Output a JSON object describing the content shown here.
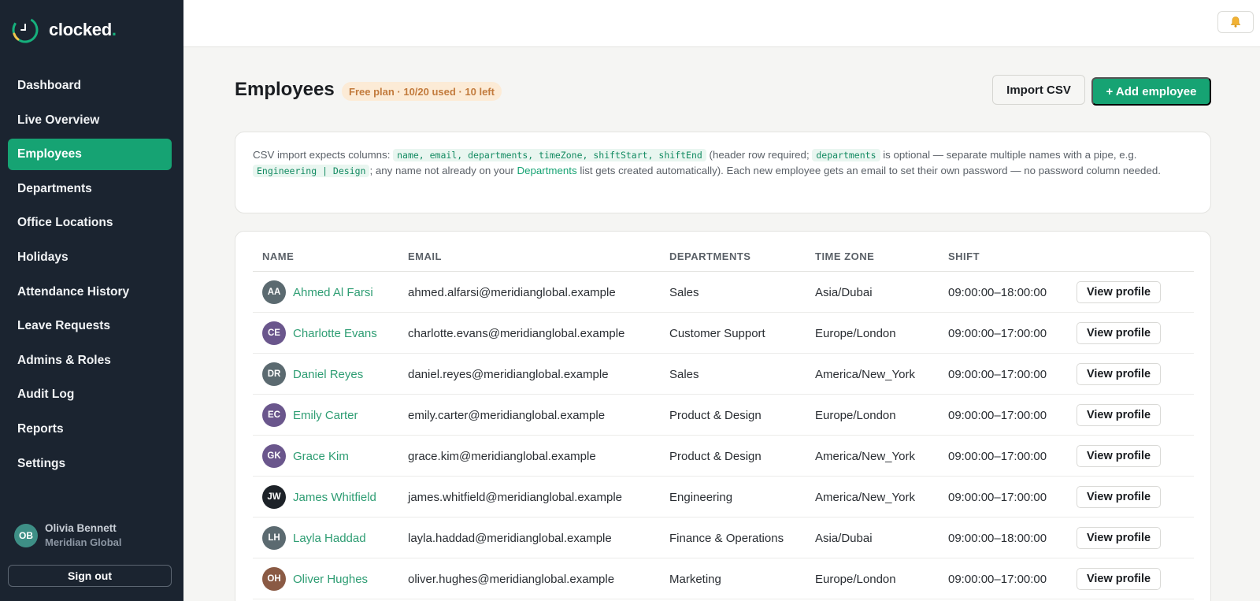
{
  "app": {
    "name": "clocked",
    "name_dot": "."
  },
  "sidebar": {
    "items": [
      {
        "label": "Dashboard"
      },
      {
        "label": "Live Overview"
      },
      {
        "label": "Employees",
        "active": true
      },
      {
        "label": "Departments"
      },
      {
        "label": "Office Locations"
      },
      {
        "label": "Holidays"
      },
      {
        "label": "Attendance History"
      },
      {
        "label": "Leave Requests"
      },
      {
        "label": "Admins & Roles"
      },
      {
        "label": "Audit Log"
      },
      {
        "label": "Reports"
      },
      {
        "label": "Settings"
      }
    ],
    "user": {
      "initials": "OB",
      "name": "Olivia Bennett",
      "org": "Meridian Global"
    },
    "signout_label": "Sign out"
  },
  "topbar": {
    "bell_icon": "bell-icon"
  },
  "header": {
    "title": "Employees",
    "plan_badge": "Free plan · 10/20 used · 10 left",
    "import_label": "Import CSV",
    "add_label": "+ Add employee"
  },
  "info": {
    "t1": "CSV import expects columns: ",
    "code1": "name, email, departments, timeZone, shiftStart, shiftEnd",
    "t2": " (header row required; ",
    "code2": "departments",
    "t3": " is optional — separate multiple names with a pipe, e.g. ",
    "code3": "Engineering | Design",
    "t4": "; any name not already on your ",
    "link": "Departments",
    "t5": " list gets created automatically). Each new employee gets an email to set their own password — no password column needed."
  },
  "table": {
    "headers": {
      "name": "NAME",
      "email": "EMAIL",
      "departments": "DEPARTMENTS",
      "timezone": "TIME ZONE",
      "shift": "SHIFT"
    },
    "view_label": "View profile",
    "rows": [
      {
        "initials": "AA",
        "avatar_color": "#5b6a70",
        "name": "Ahmed Al Farsi",
        "email": "ahmed.alfarsi@meridianglobal.example",
        "departments": "Sales",
        "timezone": "Asia/Dubai",
        "shift": "09:00:00–18:00:00"
      },
      {
        "initials": "CE",
        "avatar_color": "#6a568c",
        "name": "Charlotte Evans",
        "email": "charlotte.evans@meridianglobal.example",
        "departments": "Customer Support",
        "timezone": "Europe/London",
        "shift": "09:00:00–17:00:00"
      },
      {
        "initials": "DR",
        "avatar_color": "#5b6a70",
        "name": "Daniel Reyes",
        "email": "daniel.reyes@meridianglobal.example",
        "departments": "Sales",
        "timezone": "America/New_York",
        "shift": "09:00:00–17:00:00"
      },
      {
        "initials": "EC",
        "avatar_color": "#6a568c",
        "name": "Emily Carter",
        "email": "emily.carter@meridianglobal.example",
        "departments": "Product & Design",
        "timezone": "Europe/London",
        "shift": "09:00:00–17:00:00"
      },
      {
        "initials": "GK",
        "avatar_color": "#6a568c",
        "name": "Grace Kim",
        "email": "grace.kim@meridianglobal.example",
        "departments": "Product & Design",
        "timezone": "America/New_York",
        "shift": "09:00:00–17:00:00"
      },
      {
        "initials": "JW",
        "avatar_color": "#1d2228",
        "name": "James Whitfield",
        "email": "james.whitfield@meridianglobal.example",
        "departments": "Engineering",
        "timezone": "America/New_York",
        "shift": "09:00:00–17:00:00"
      },
      {
        "initials": "LH",
        "avatar_color": "#5b6a70",
        "name": "Layla Haddad",
        "email": "layla.haddad@meridianglobal.example",
        "departments": "Finance & Operations",
        "timezone": "Asia/Dubai",
        "shift": "09:00:00–18:00:00"
      },
      {
        "initials": "OH",
        "avatar_color": "#8a5a44",
        "name": "Oliver Hughes",
        "email": "oliver.hughes@meridianglobal.example",
        "departments": "Marketing",
        "timezone": "Europe/London",
        "shift": "09:00:00–17:00:00"
      }
    ]
  }
}
